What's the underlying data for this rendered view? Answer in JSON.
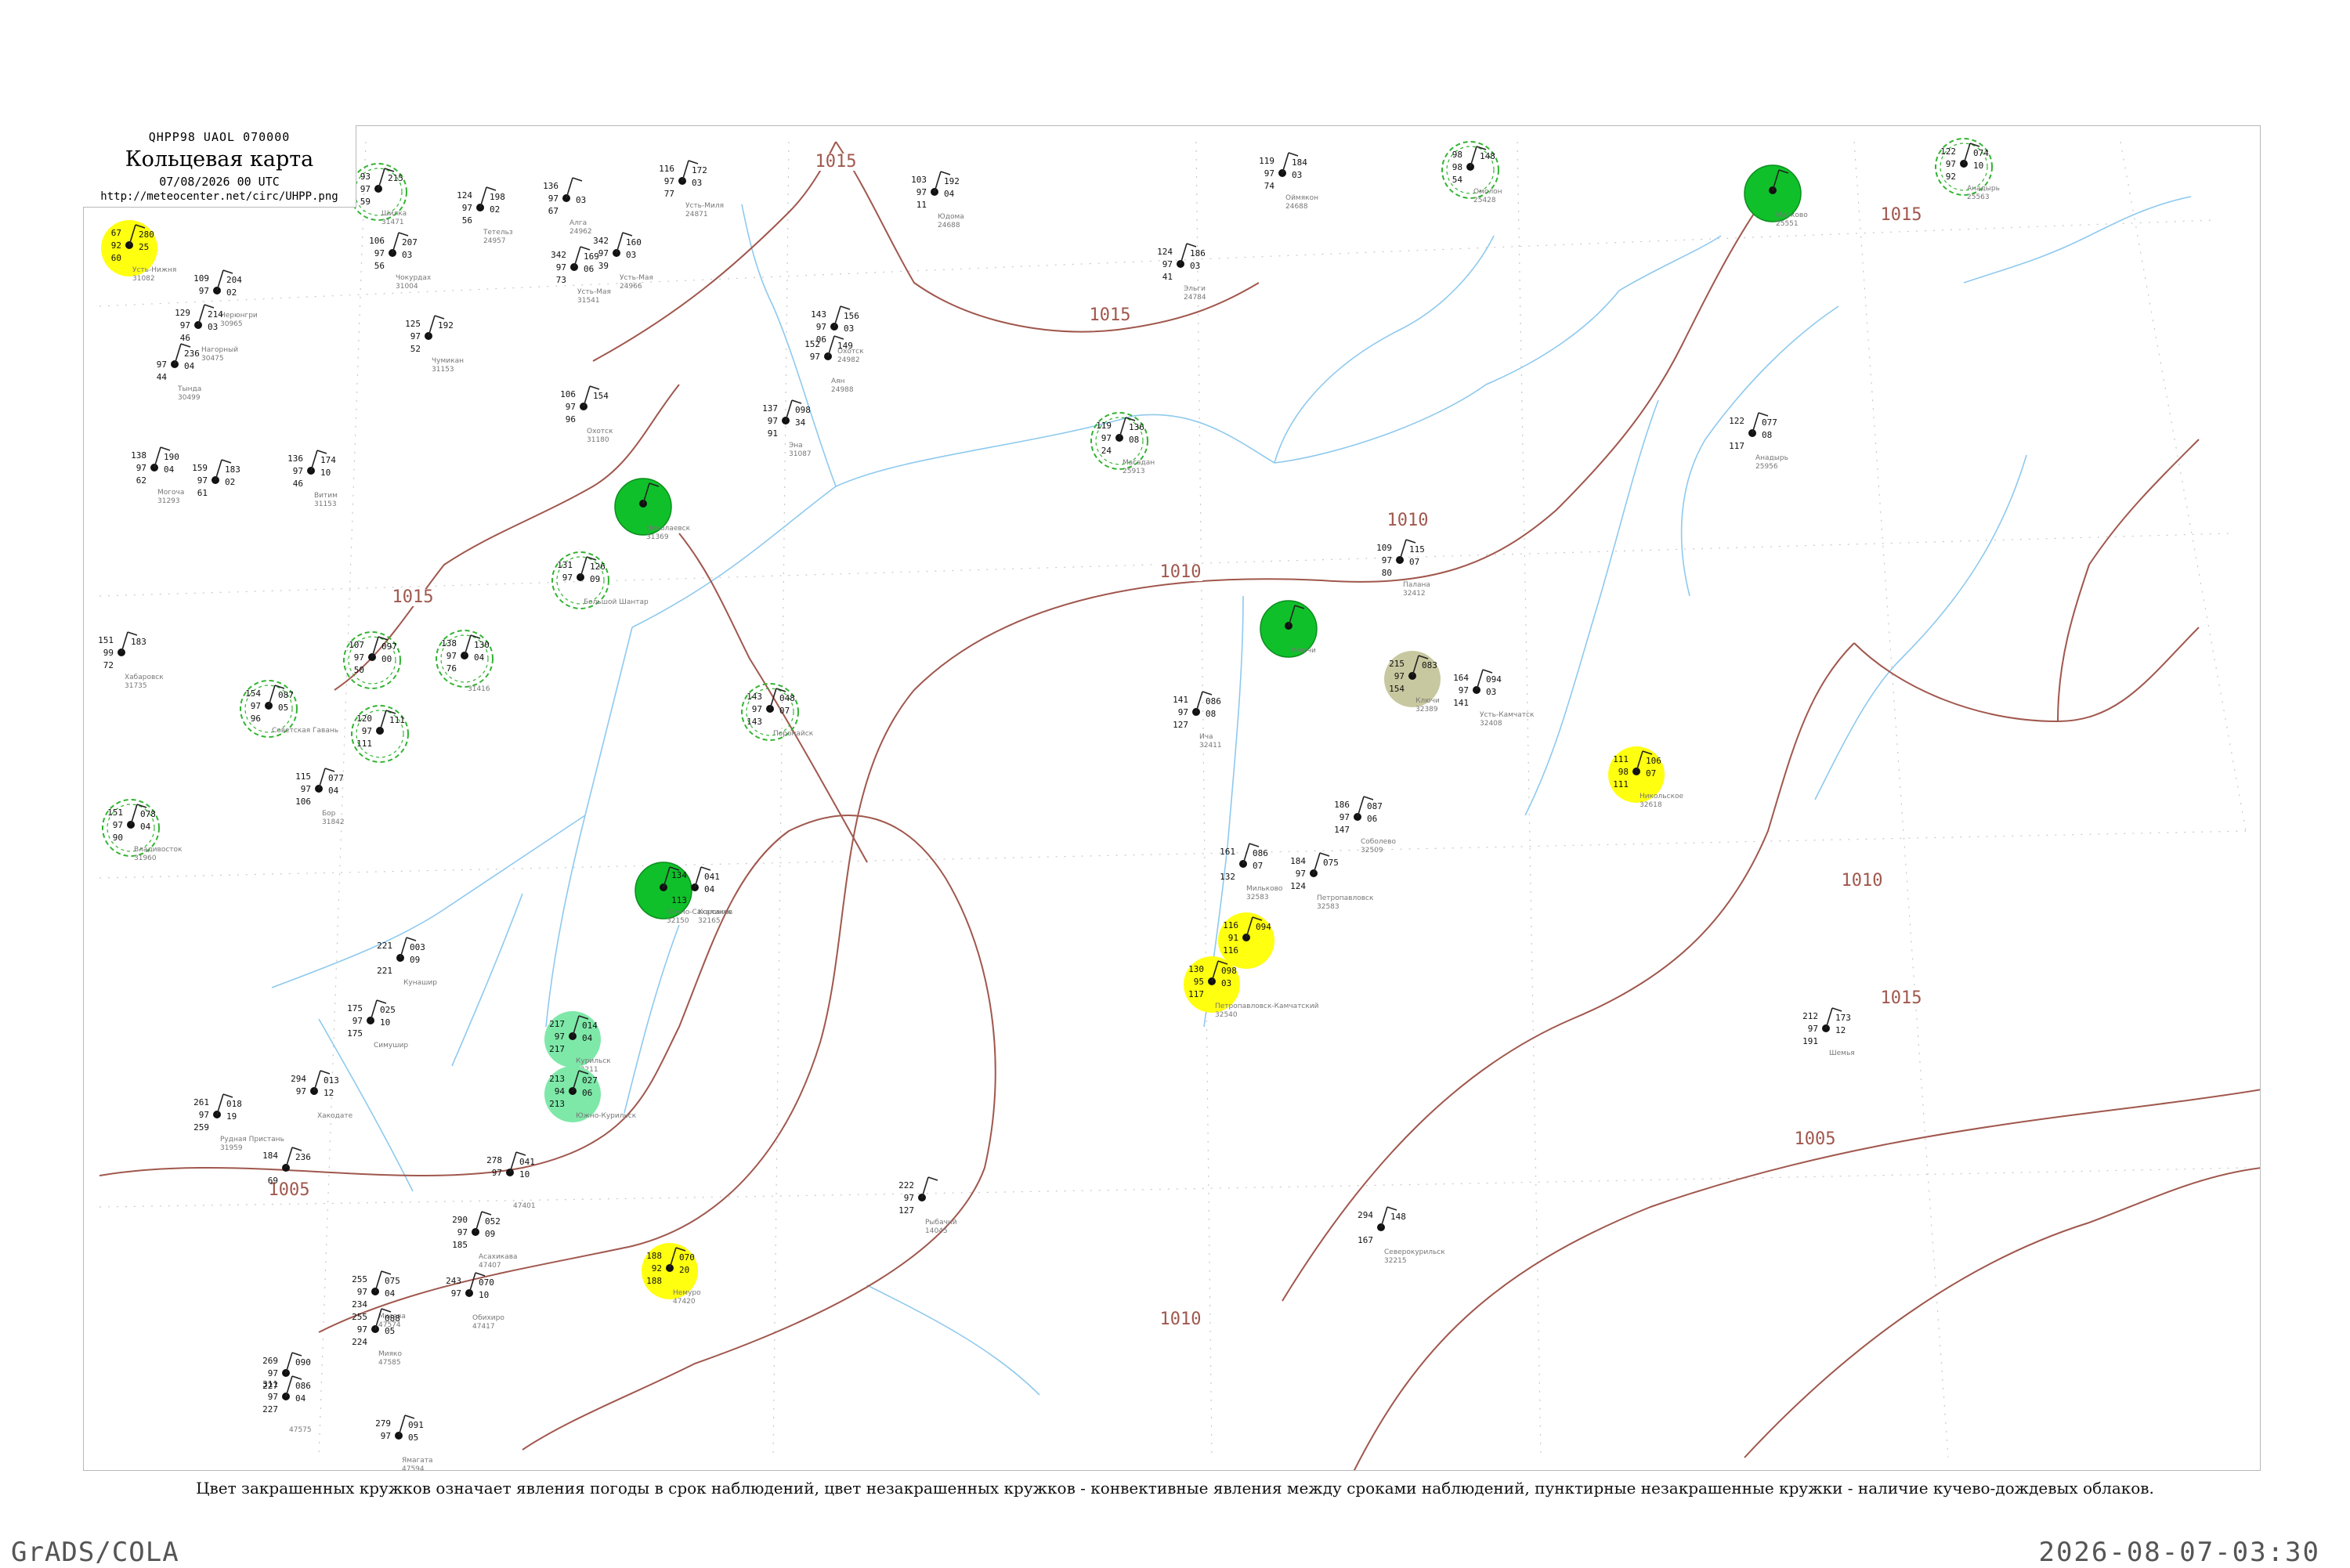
{
  "header": {
    "code": "QHPP98  UAOL  070000",
    "title": "Кольцевая карта",
    "datetime": "07/08/2026 00 UTC",
    "url": "http://meteocenter.net/circ/UHPP.png"
  },
  "caption": "Цвет закрашенных кружков означает явления погоды в срок наблюдений, цвет незакрашенных кружков - конвективные явления между сроками наблюдений, пунктирные незакрашенные кружки - наличие кучево-дождевых облаков.",
  "footer": {
    "left": "GrADS/COLA",
    "right": "2026-08-07-03:30"
  },
  "colors": {
    "isobar": "#a0574d",
    "river": "#8ec9ee",
    "grid": "#c8c8c8",
    "rain": "#10c02a",
    "drizzle": "#7ee8a8",
    "fog": "#ffff10",
    "haze": "#c8c8a0",
    "cb": "#32b432"
  },
  "isobars": [
    "1015",
    "1015",
    "1015",
    "1015",
    "1010",
    "1010",
    "1010",
    "1010",
    "1005",
    "1005",
    "1015"
  ],
  "stations": [
    {
      "t": "67",
      "v": "92",
      "n": "60",
      "r": "280",
      "w": "25",
      "name": "Усть-Нижня",
      "id": "31082",
      "mark": "fog"
    },
    {
      "t": "93",
      "v": "97",
      "n": "59",
      "r": "215",
      "w": "",
      "name": "Шилка",
      "id": "31471",
      "mark": "cb"
    },
    {
      "t": "124",
      "v": "97",
      "n": "56",
      "r": "198",
      "w": "02",
      "name": "Тетельз",
      "id": "24957",
      "mark": ""
    },
    {
      "t": "136",
      "v": "97",
      "n": "67",
      "r": "",
      "w": "03",
      "name": "Алга",
      "id": "24962",
      "mark": ""
    },
    {
      "t": "116",
      "v": "97",
      "n": "77",
      "r": "172",
      "w": "03",
      "name": "Усть-Миля",
      "id": "24871",
      "mark": ""
    },
    {
      "t": "103",
      "v": "97",
      "n": "11",
      "r": "192",
      "w": "04",
      "name": "Юдома",
      "id": "24688",
      "mark": ""
    },
    {
      "t": "119",
      "v": "97",
      "n": "74",
      "r": "184",
      "w": "03",
      "name": "Оймякон",
      "id": "24688",
      "mark": ""
    },
    {
      "t": "98",
      "v": "98",
      "n": "54",
      "r": "148",
      "w": "",
      "name": "Омолон",
      "id": "25428",
      "mark": "cb"
    },
    {
      "t": "",
      "v": "",
      "n": "",
      "r": "",
      "w": "",
      "name": "Марково",
      "id": "25551",
      "mark": "rain"
    },
    {
      "t": "122",
      "v": "97",
      "n": "92",
      "r": "074",
      "w": "10",
      "name": "Анадырь",
      "id": "25563",
      "mark": "cb"
    },
    {
      "t": "106",
      "v": "97",
      "n": "56",
      "r": "207",
      "w": "03",
      "name": "Чокурдах",
      "id": "31004",
      "mark": ""
    },
    {
      "t": "342",
      "v": "97",
      "n": "73",
      "r": "169",
      "w": "06",
      "name": "Усть-Мая",
      "id": "31541",
      "mark": ""
    },
    {
      "t": "342",
      "v": "97",
      "n": "39",
      "r": "160",
      "w": "03",
      "name": "Усть-Мая",
      "id": "24966",
      "mark": ""
    },
    {
      "t": "124",
      "v": "97",
      "n": "41",
      "r": "186",
      "w": "03",
      "name": "Эльги",
      "id": "24784",
      "mark": ""
    },
    {
      "t": "109",
      "v": "97",
      "n": "",
      "r": "204",
      "w": "02",
      "name": "Нерюнгри",
      "id": "30965",
      "mark": ""
    },
    {
      "t": "129",
      "v": "97",
      "n": "46",
      "r": "214",
      "w": "03",
      "name": "Нагорный",
      "id": "30475",
      "mark": ""
    },
    {
      "t": "125",
      "v": "97",
      "n": "52",
      "r": "192",
      "w": "",
      "name": "Чумикан",
      "id": "31153",
      "mark": ""
    },
    {
      "t": "",
      "v": "97",
      "n": "44",
      "r": "236",
      "w": "04",
      "name": "Тында",
      "id": "30499",
      "mark": ""
    },
    {
      "t": "143",
      "v": "97",
      "n": "06",
      "r": "156",
      "w": "03",
      "name": "Охотск",
      "id": "24982",
      "mark": ""
    },
    {
      "t": "152",
      "v": "97",
      "n": "",
      "r": "149",
      "w": "",
      "name": "Аян",
      "id": "24988",
      "mark": ""
    },
    {
      "t": "106",
      "v": "97",
      "n": "96",
      "r": "154",
      "w": "",
      "name": "Охотск",
      "id": "31180",
      "mark": ""
    },
    {
      "t": "137",
      "v": "97",
      "n": "91",
      "r": "098",
      "w": "34",
      "name": "Эна",
      "id": "31087",
      "mark": ""
    },
    {
      "t": "119",
      "v": "97",
      "n": "24",
      "r": "136",
      "w": "08",
      "name": "Магадан",
      "id": "25913",
      "mark": "cb"
    },
    {
      "t": "138",
      "v": "97",
      "n": "62",
      "r": "190",
      "w": "04",
      "name": "Могоча",
      "id": "31293",
      "mark": ""
    },
    {
      "t": "159",
      "v": "97",
      "n": "61",
      "r": "183",
      "w": "02",
      "name": "",
      "id": "",
      "mark": ""
    },
    {
      "t": "136",
      "v": "97",
      "n": "46",
      "r": "174",
      "w": "10",
      "name": "Витим",
      "id": "31153",
      "mark": ""
    },
    {
      "t": "",
      "v": "",
      "n": "",
      "r": "",
      "w": "",
      "name": "Николаевск",
      "id": "31369",
      "mark": "rain"
    },
    {
      "t": "131",
      "v": "97",
      "n": "",
      "r": "126",
      "w": "09",
      "name": "Большой Шантар",
      "id": "",
      "mark": "cb"
    },
    {
      "t": "109",
      "v": "97",
      "n": "80",
      "r": "115",
      "w": "07",
      "name": "Палана",
      "id": "32412",
      "mark": ""
    },
    {
      "t": "",
      "v": "",
      "n": "",
      "r": "",
      "w": "",
      "name": "Ключи",
      "id": "",
      "mark": "rain"
    },
    {
      "t": "215",
      "v": "97",
      "n": "154",
      "r": "083",
      "w": "",
      "name": "Ключи",
      "id": "32389",
      "mark": "haze"
    },
    {
      "t": "164",
      "v": "97",
      "n": "141",
      "r": "094",
      "w": "03",
      "name": "Усть-Камчатск",
      "id": "32408",
      "mark": ""
    },
    {
      "t": "141",
      "v": "97",
      "n": "127",
      "r": "086",
      "w": "08",
      "name": "Ича",
      "id": "32411",
      "mark": ""
    },
    {
      "t": "111",
      "v": "98",
      "n": "111",
      "r": "106",
      "w": "07",
      "name": "Никольское",
      "id": "32618",
      "mark": "fog"
    },
    {
      "t": "186",
      "v": "97",
      "n": "147",
      "r": "087",
      "w": "06",
      "name": "Соболево",
      "id": "32509",
      "mark": ""
    },
    {
      "t": "161",
      "v": "",
      "n": "132",
      "r": "086",
      "w": "07",
      "name": "Мильково",
      "id": "32583",
      "mark": ""
    },
    {
      "t": "184",
      "v": "97",
      "n": "124",
      "r": "075",
      "w": "",
      "name": "Петропавловск",
      "id": "32583",
      "mark": ""
    },
    {
      "t": "116",
      "v": "91",
      "n": "116",
      "r": "094",
      "w": "",
      "name": "",
      "id": "",
      "mark": "fog"
    },
    {
      "t": "130",
      "v": "95",
      "n": "117",
      "r": "098",
      "w": "03",
      "name": "Петропавловск-Камчатский",
      "id": "32540",
      "mark": "fog"
    },
    {
      "t": "212",
      "v": "97",
      "n": "191",
      "r": "173",
      "w": "12",
      "name": "Шемья",
      "id": "",
      "mark": ""
    },
    {
      "t": "122",
      "v": "",
      "n": "117",
      "r": "077",
      "w": "08",
      "name": "Анадырь",
      "id": "25956",
      "mark": ""
    },
    {
      "t": "151",
      "v": "99",
      "n": "72",
      "r": "183",
      "w": "",
      "name": "Хабаровск",
      "id": "31735",
      "mark": ""
    },
    {
      "t": "107",
      "v": "97",
      "n": "50",
      "r": "097",
      "w": "00",
      "name": "",
      "id": "",
      "mark": "cb"
    },
    {
      "t": "138",
      "v": "97",
      "n": "76",
      "r": "130",
      "w": "04",
      "name": "",
      "id": "31416",
      "mark": "cb"
    },
    {
      "t": "143",
      "v": "97",
      "n": "143",
      "r": "048",
      "w": "07",
      "name": "Поронайск",
      "id": "",
      "mark": "cb"
    },
    {
      "t": "154",
      "v": "97",
      "n": "96",
      "r": "087",
      "w": "05",
      "name": "Советская Гавань",
      "id": "",
      "mark": "cb"
    },
    {
      "t": "120",
      "v": "97",
      "n": "111",
      "r": "111",
      "w": "",
      "name": "",
      "id": "",
      "mark": "cb"
    },
    {
      "t": "115",
      "v": "97",
      "n": "106",
      "r": "077",
      "w": "04",
      "name": "Бор",
      "id": "31842",
      "mark": ""
    },
    {
      "t": "151",
      "v": "97",
      "n": "90",
      "r": "078",
      "w": "04",
      "name": "Владивосток",
      "id": "31960",
      "mark": "cb"
    },
    {
      "t": "",
      "v": "",
      "n": "",
      "r": "",
      "w": "",
      "name": "Южно-Сахалинск",
      "id": "32150",
      "mark": "rain"
    },
    {
      "t": "134",
      "v": "",
      "n": "113",
      "r": "041",
      "w": "04",
      "name": "Корсаков",
      "id": "32165",
      "mark": ""
    },
    {
      "t": "221",
      "v": "",
      "n": "221",
      "r": "003",
      "w": "09",
      "name": "Кунашир",
      "id": "",
      "mark": ""
    },
    {
      "t": "175",
      "v": "97",
      "n": "175",
      "r": "025",
      "w": "10",
      "name": "Симушир",
      "id": "",
      "mark": ""
    },
    {
      "t": "217",
      "v": "97",
      "n": "217",
      "r": "014",
      "w": "04",
      "name": "Курильск",
      "id": "32211",
      "mark": "drizzle"
    },
    {
      "t": "213",
      "v": "94",
      "n": "213",
      "r": "027",
      "w": "06",
      "name": "Южно-Курильск",
      "id": "",
      "mark": "drizzle"
    },
    {
      "t": "294",
      "v": "97",
      "n": "",
      "r": "013",
      "w": "12",
      "name": "Хакодате",
      "id": "",
      "mark": ""
    },
    {
      "t": "261",
      "v": "97",
      "n": "259",
      "r": "018",
      "w": "19",
      "name": "Рудная Пристань",
      "id": "31959",
      "mark": ""
    },
    {
      "t": "184",
      "v": "",
      "n": "69",
      "r": "236",
      "w": "",
      "name": "",
      "id": "",
      "mark": ""
    },
    {
      "t": "278",
      "v": "97",
      "n": "",
      "r": "041",
      "w": "10",
      "name": "",
      "id": "47401",
      "mark": ""
    },
    {
      "t": "290",
      "v": "97",
      "n": "185",
      "r": "052",
      "w": "09",
      "name": "Асахикава",
      "id": "47407",
      "mark": ""
    },
    {
      "t": "188",
      "v": "92",
      "n": "188",
      "r": "070",
      "w": "20",
      "name": "Немуро",
      "id": "47420",
      "mark": "fog"
    },
    {
      "t": "243",
      "v": "97",
      "n": "",
      "r": "070",
      "w": "10",
      "name": "Обихиро",
      "id": "47417",
      "mark": ""
    },
    {
      "t": "222",
      "v": "97",
      "n": "127",
      "r": "",
      "w": "",
      "name": "Рыбачий",
      "id": "14045",
      "mark": ""
    },
    {
      "t": "294",
      "v": "",
      "n": "167",
      "r": "148",
      "w": "",
      "name": "Северокурильск",
      "id": "32215",
      "mark": ""
    },
    {
      "t": "255",
      "v": "97",
      "n": "234",
      "r": "075",
      "w": "04",
      "name": "Мисава",
      "id": "47574",
      "mark": ""
    },
    {
      "t": "255",
      "v": "97",
      "n": "224",
      "r": "088",
      "w": "05",
      "name": "Мияко",
      "id": "47585",
      "mark": ""
    },
    {
      "t": "269",
      "v": "97",
      "n": "227",
      "r": "090",
      "w": "",
      "name": "",
      "id": "",
      "mark": ""
    },
    {
      "t": "311",
      "v": "97",
      "n": "227",
      "r": "086",
      "w": "04",
      "name": "",
      "id": "47575",
      "mark": ""
    },
    {
      "t": "279",
      "v": "97",
      "n": "",
      "r": "091",
      "w": "05",
      "name": "Ямагата",
      "id": "47594",
      "mark": ""
    }
  ]
}
